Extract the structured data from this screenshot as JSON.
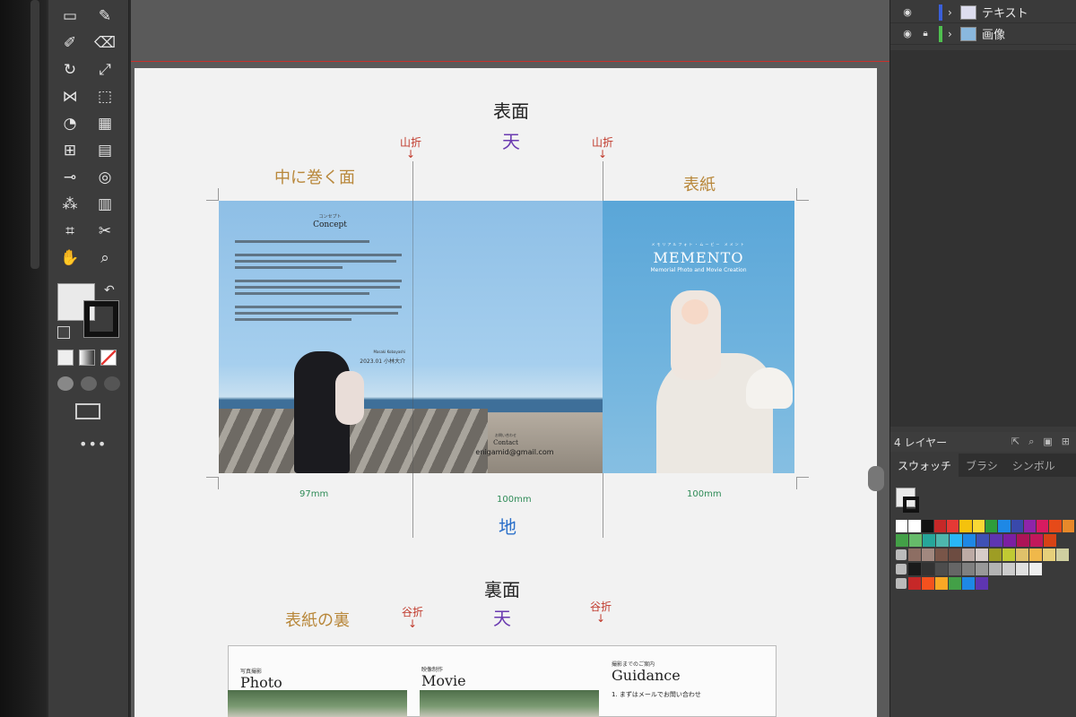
{
  "layers": [
    {
      "name": "テキスト",
      "color": "#3a5fd9",
      "locked": false
    },
    {
      "name": "画像",
      "color": "#4fbf4f",
      "locked": true
    }
  ],
  "layers_footer": {
    "label": "4 レイヤー"
  },
  "panel_tabs": [
    "スウォッチ",
    "ブラシ",
    "シンボル"
  ],
  "artboard": {
    "front_heading": "表面",
    "back_heading": "裏面",
    "ten": "天",
    "chi": "地",
    "fold_mountain": "山折",
    "fold_valley": "谷折",
    "arrow": "↓",
    "panel_inner": "中に巻く面",
    "panel_cover": "表紙",
    "panel_back_cover": "表紙の裏",
    "mm_left": "97mm",
    "mm_mid": "100mm",
    "mm_right": "100mm"
  },
  "inner": {
    "concept_kana": "コンセプト",
    "concept_title": "Concept",
    "signature_kana": "Masaki Kobayashi",
    "signature": "2023.01  小林大介",
    "contact_kana": "お問い合わせ",
    "contact_title": "Contact",
    "email": "enigamid@gmail.com"
  },
  "cover": {
    "kana": "メモリアルフォト・ムービー メメント",
    "title": "MEMENTO",
    "subtitle": "Memorial Photo and Movie Creation"
  },
  "back": {
    "photo_kana": "写真撮影",
    "photo_title": "Photo",
    "movie_kana": "映像制作",
    "movie_title": "Movie",
    "guidance_kana": "撮影までのご案内",
    "guidance_title": "Guidance",
    "guidance_step": "1. まずはメールでお問い合わせ"
  },
  "swatch_colors": [
    [
      "#ffffff",
      "#ffffff",
      "#111111",
      "#c62828",
      "#e53935",
      "#f4c20d",
      "#f9d835",
      "#2e9d3a",
      "#1e88e5",
      "#3949ab",
      "#8e24aa",
      "#d81b60",
      "#e64a19",
      "#e8892a"
    ],
    [
      "#43a047",
      "#66bb6a",
      "#26a69a",
      "#4db6ac",
      "#29b6f6",
      "#1e88e5",
      "#3f51b5",
      "#5e35b1",
      "#7b1fa2",
      "#ad1457",
      "#c2185b",
      "#d84315"
    ],
    [
      "#8d6e63",
      "#a1887f",
      "#795548",
      "#6d4c41",
      "#bcaaa4",
      "#d7ccc8",
      "#9e9d24",
      "#c0ca33",
      "#e0c16a",
      "#f0b84a",
      "#e6d07a",
      "#cfcfa0"
    ],
    [
      "#1a1a1a",
      "#333333",
      "#4d4d4d",
      "#666666",
      "#808080",
      "#999999",
      "#b3b3b3",
      "#cccccc",
      "#e0e0e0",
      "#eeeeee"
    ],
    [
      "#c62828",
      "#f4511e",
      "#f9a825",
      "#43a047",
      "#1e88e5",
      "#5e35b1"
    ]
  ]
}
